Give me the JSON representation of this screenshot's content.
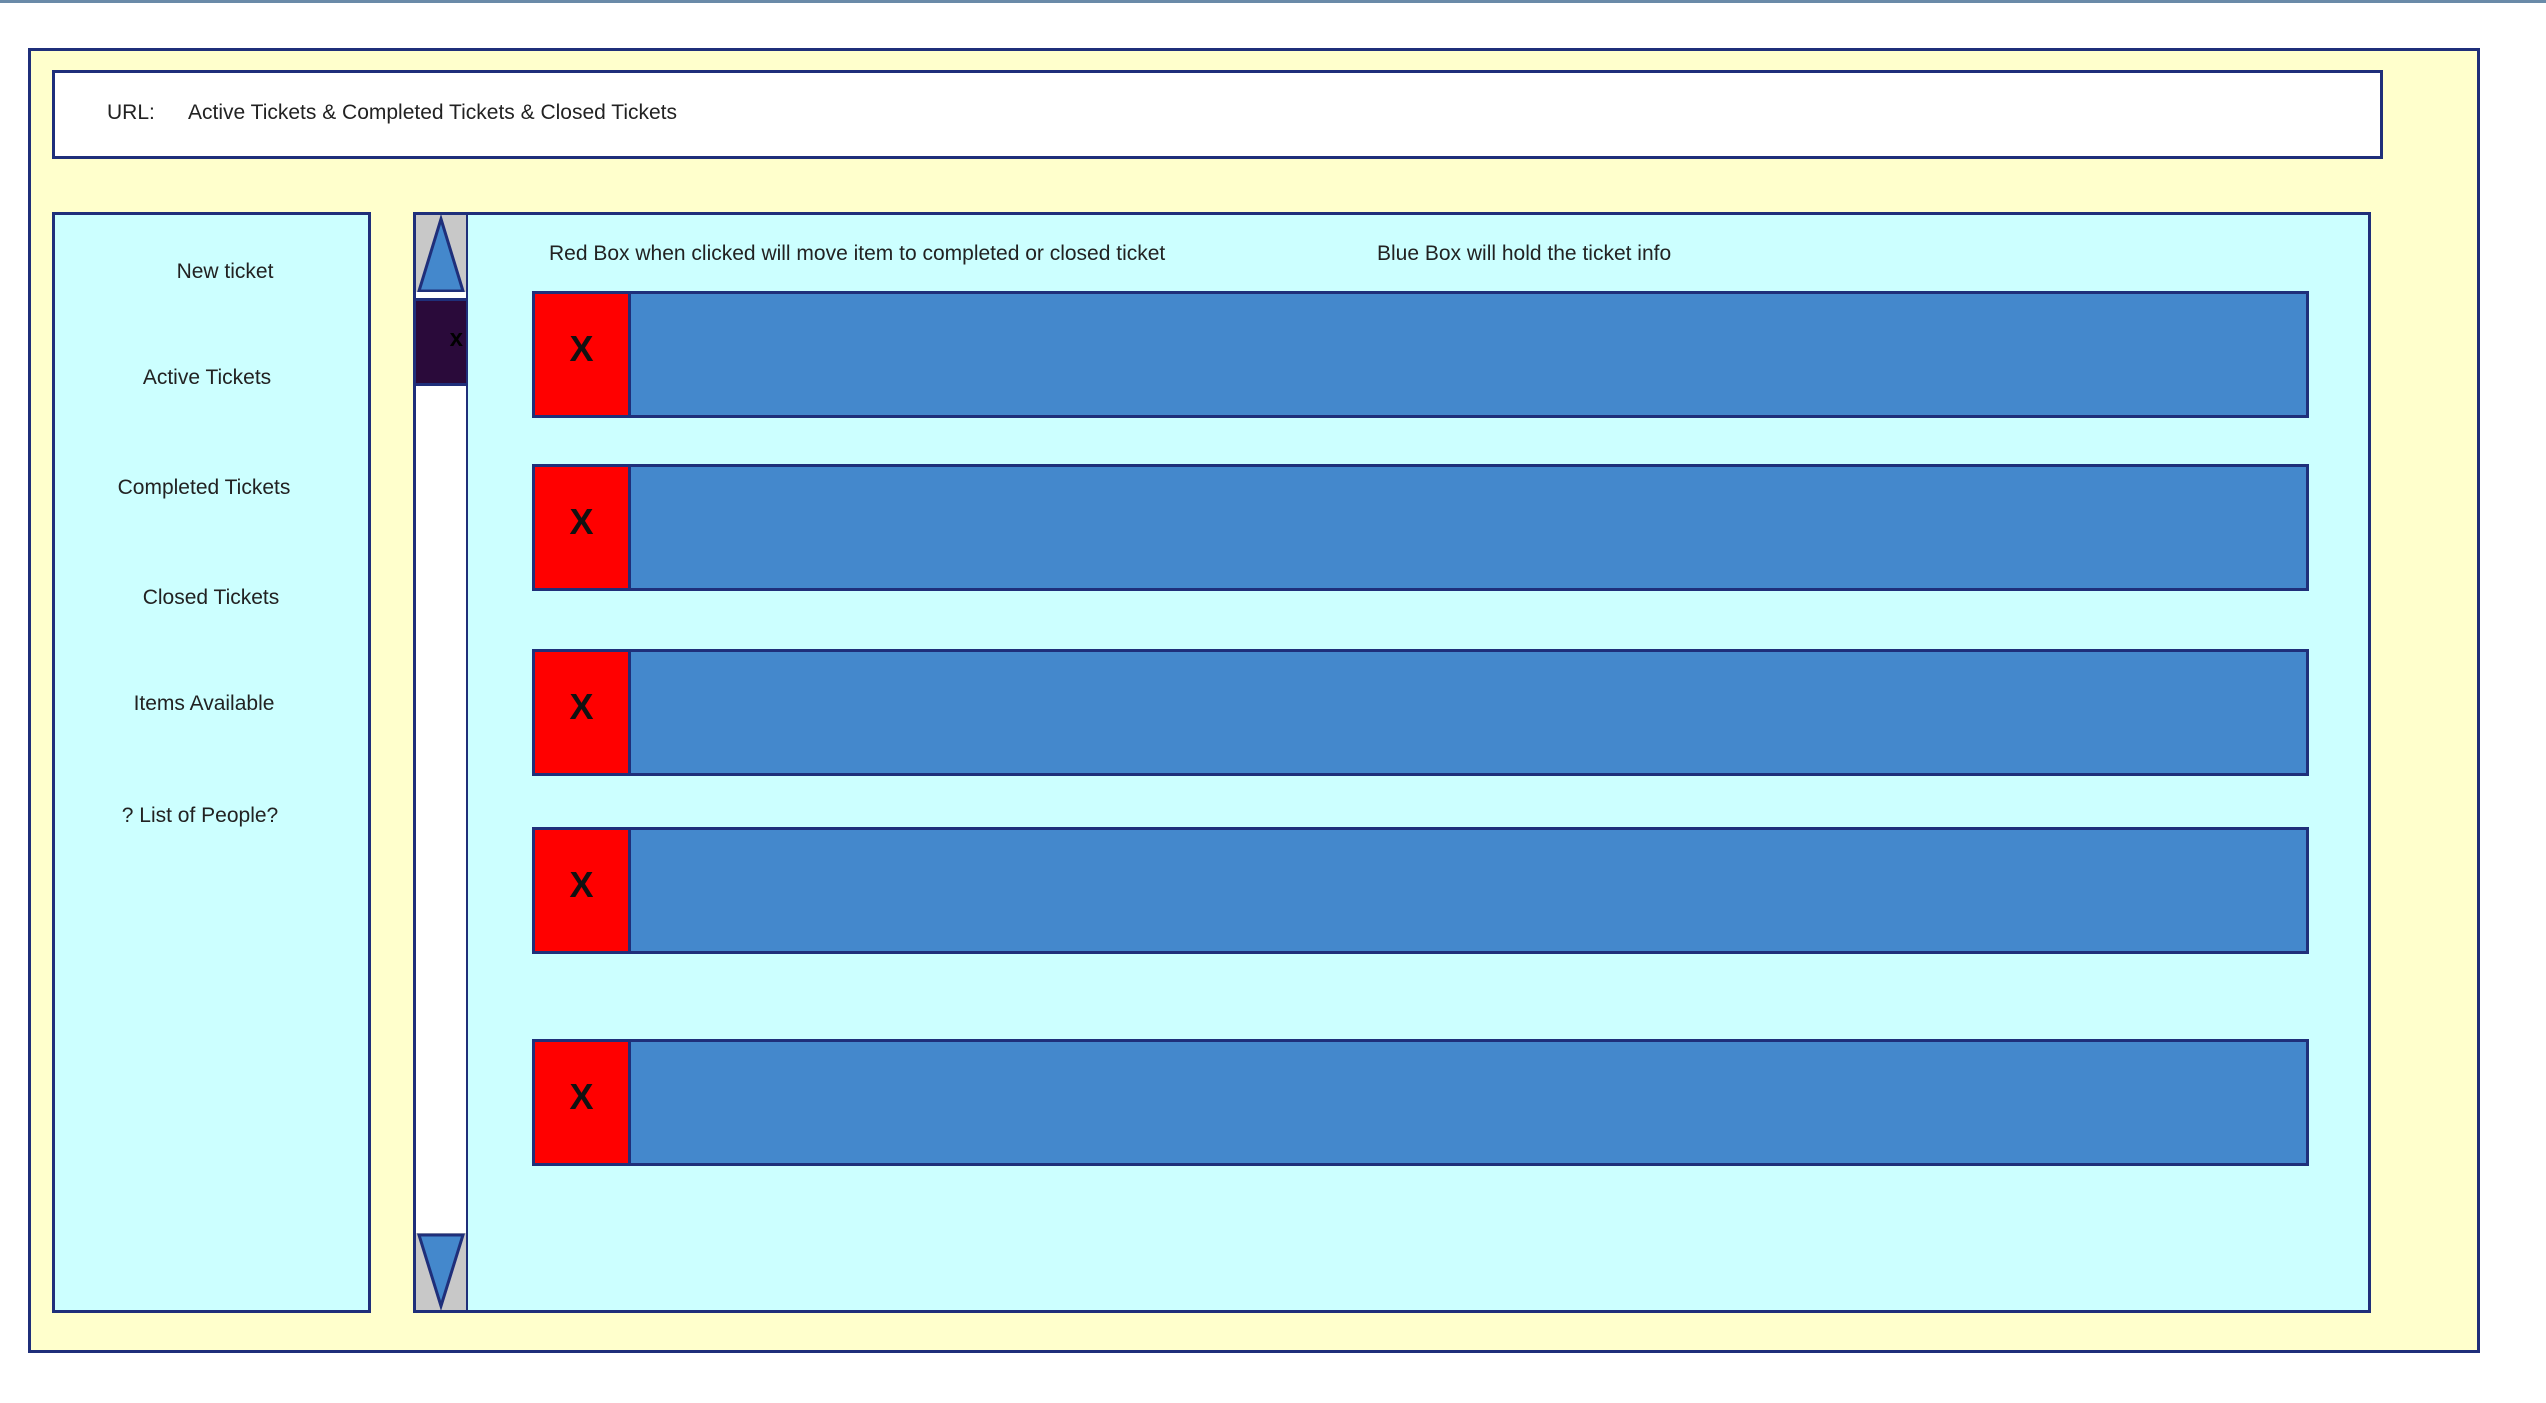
{
  "url_bar": {
    "label": "URL:",
    "value": "Active Tickets & Completed Tickets & Closed Tickets"
  },
  "sidebar": {
    "items": [
      {
        "label": "New ticket"
      },
      {
        "label": "Active Tickets"
      },
      {
        "label": "Completed Tickets"
      },
      {
        "label": "Closed Tickets"
      },
      {
        "label": "Items Available"
      },
      {
        "label": "? List of People?"
      }
    ]
  },
  "scrollbar": {
    "up_icon": "triangle-up-icon",
    "down_icon": "triangle-down-icon",
    "thumb_label": "x"
  },
  "main": {
    "note_red": "Red Box when clicked will move item to completed or closed ticket",
    "note_blue": "Blue Box will hold the ticket info",
    "tickets": [
      {
        "close_label": "X",
        "info": ""
      },
      {
        "close_label": "X",
        "info": ""
      },
      {
        "close_label": "X",
        "info": ""
      },
      {
        "close_label": "X",
        "info": ""
      },
      {
        "close_label": "X",
        "info": ""
      }
    ]
  },
  "colors": {
    "frame_bg": "#ffffcc",
    "panel_bg": "#ccffff",
    "border": "#1f2f7a",
    "close_box": "#ff0000",
    "info_box": "#4488cc",
    "scroll_thumb": "#2a0a3a",
    "scroll_button": "#c8c8c8"
  }
}
